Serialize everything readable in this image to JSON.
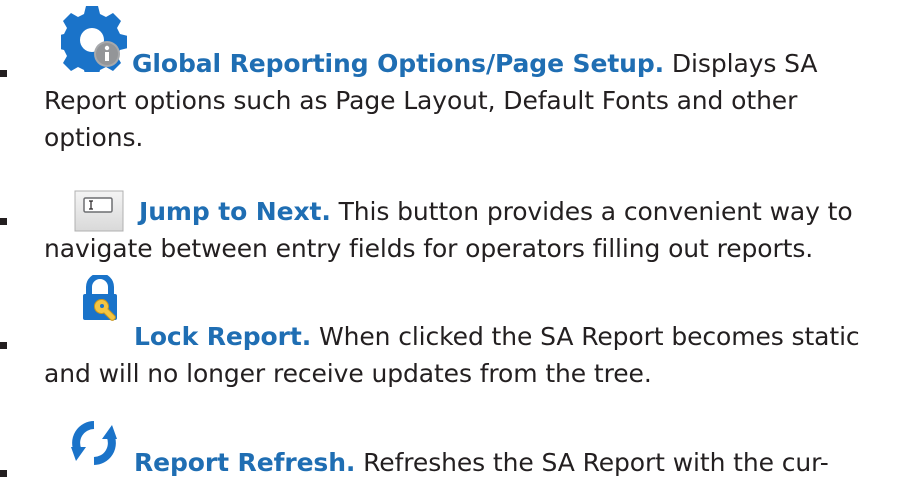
{
  "items": [
    {
      "icon": "gear-info-icon",
      "title": "Global Reporting Options/Page Setup.",
      "description": " Displays SA Report options such as Page Layout, Default Fonts and other options."
    },
    {
      "icon": "jump-to-next-field-icon",
      "title": "Jump to Next.",
      "description": " This button provides a convenient way to navigate between entry fields for operators filling out reports."
    },
    {
      "icon": "lock-report-icon",
      "title": "Lock Report.",
      "description": " When clicked the SA Report becomes static and will no longer receive updates from the tree."
    },
    {
      "icon": "refresh-icon",
      "title": "Report Refresh.",
      "description": " Refreshes the SA Report with the cur-"
    }
  ],
  "colors": {
    "title": "#1f6eb3",
    "body_text": "#231f20",
    "icon_blue": "#1a73c9"
  }
}
